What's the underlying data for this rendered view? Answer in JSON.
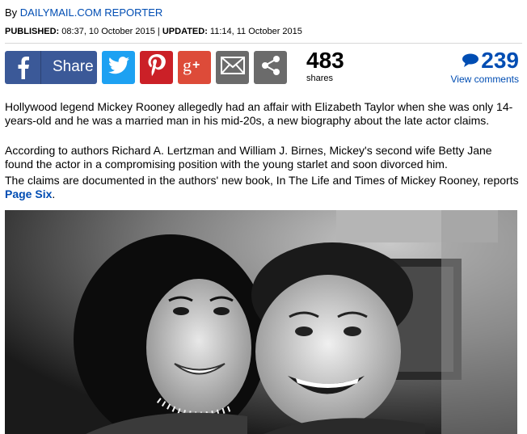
{
  "byline": {
    "prefix": "By ",
    "author": "DAILYMAIL.COM REPORTER"
  },
  "dates": {
    "published_label": "PUBLISHED:",
    "published_value": " 08:37, 10 October 2015 | ",
    "updated_label": "UPDATED:",
    "updated_value": " 11:14, 11 October 2015"
  },
  "share": {
    "facebook_label": "Share",
    "count": "483",
    "count_label": "shares",
    "colors": {
      "facebook": "#3b5998",
      "twitter": "#1da1f2",
      "pinterest": "#cb2027",
      "googleplus": "#dd4b39",
      "mail": "#6b6b6b",
      "more": "#6b6b6b"
    },
    "icons": [
      "facebook-icon",
      "twitter-icon",
      "pinterest-icon",
      "google-plus-icon",
      "mail-icon",
      "share-more-icon"
    ]
  },
  "comments": {
    "count": "239",
    "link_label": "View comments"
  },
  "article": {
    "paragraph1": "Hollywood legend Mickey Rooney allegedly had an affair with Elizabeth Taylor when she was only 14-years-old and he was a married man in his mid-20s, a new biography about the late actor claims.",
    "paragraph2": "According to authors Richard A. Lertzman and William J. Birnes, Mickey's second wife Betty Jane found the actor in a compromising position with the young starlet and soon divorced him.",
    "paragraph3_text": "The claims are documented in the authors' new book, In The Life and Times of Mickey Rooney, reports ",
    "paragraph3_link": "Page Six",
    "paragraph3_end": "."
  },
  "accent_color": "#004db3"
}
